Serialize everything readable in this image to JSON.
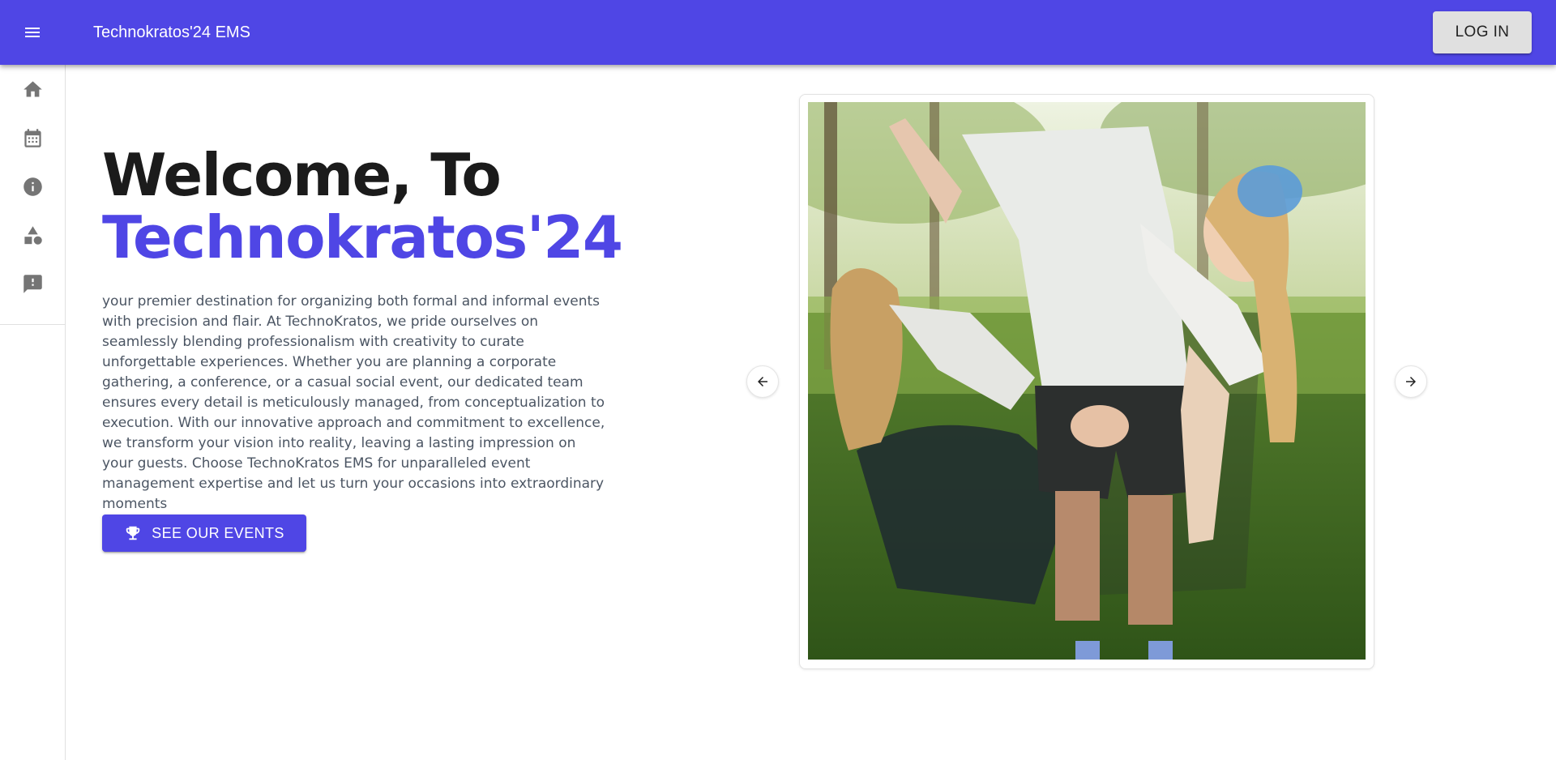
{
  "appbar": {
    "title": "Technokratos'24 EMS",
    "login_label": "LOG IN",
    "menu_icon": "hamburger-menu-icon",
    "color": "#4f46e5"
  },
  "sidebar": {
    "items": [
      {
        "icon": "home-icon"
      },
      {
        "icon": "calendar-icon"
      },
      {
        "icon": "info-icon"
      },
      {
        "icon": "category-shapes-icon"
      },
      {
        "icon": "feedback-icon"
      }
    ]
  },
  "hero": {
    "title_line1": "Welcome, To",
    "title_line2": "Technokratos'24",
    "description": "your premier destination for organizing both formal and informal events with precision and flair. At TechnoKratos, we pride ourselves on seamlessly blending professionalism with creativity to curate unforgettable experiences. Whether you are planning a corporate gathering, a conference, or a casual social event, our dedicated team ensures every detail is meticulously managed, from conceptualization to execution. With our innovative approach and commitment to excellence, we transform your vision into reality, leaving a lasting impression on your guests. Choose TechnoKratos EMS for unparalleled event management expertise and let us turn your occasions into extraordinary moments",
    "cta_label": "SEE OUR EVENTS",
    "cta_icon": "trophy-icon",
    "accent": "#4f46e5"
  },
  "carousel": {
    "prev_icon": "arrow-left-icon",
    "next_icon": "arrow-right-icon"
  }
}
